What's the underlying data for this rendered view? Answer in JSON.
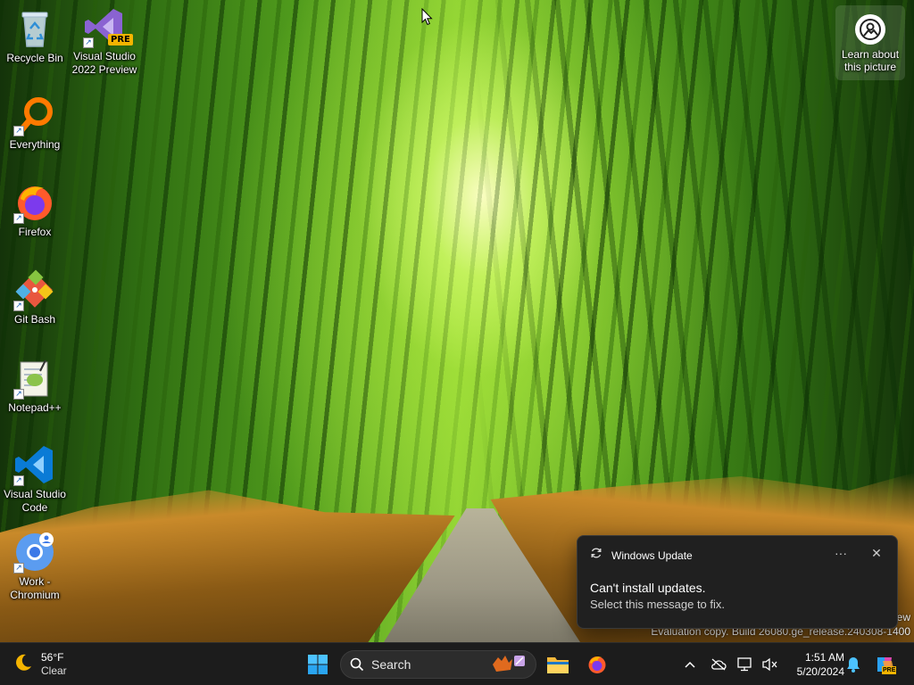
{
  "desktop_icons": [
    {
      "label_line1": "Recycle Bin",
      "label_line2": ""
    },
    {
      "label_line1": "Visual Studio",
      "label_line2": "2022 Preview",
      "badge": "PRE"
    },
    {
      "label_line1": "Everything",
      "label_line2": ""
    },
    {
      "label_line1": "Firefox",
      "label_line2": ""
    },
    {
      "label_line1": "Git Bash",
      "label_line2": ""
    },
    {
      "label_line1": "Notepad++",
      "label_line2": ""
    },
    {
      "label_line1": "Visual Studio",
      "label_line2": "Code"
    },
    {
      "label_line1": "Work -",
      "label_line2": "Chromium"
    }
  ],
  "learn_picture": {
    "line1": "Learn about",
    "line2": "this picture"
  },
  "watermark": {
    "line1": "ew",
    "line2": "Evaluation copy. Build 26080.ge_release.240308-1400"
  },
  "notification": {
    "app_name": "Windows Update",
    "more_label": "···",
    "close_label": "✕",
    "title": "Can't install updates.",
    "body": "Select this message to fix."
  },
  "taskbar": {
    "weather": {
      "temp": "56°F",
      "condition": "Clear"
    },
    "search_placeholder": "Search",
    "clock": {
      "time": "1:51 AM",
      "date": "5/20/2024"
    },
    "copilot_badge": "PRE"
  },
  "colors": {
    "accent": "#0078d4",
    "taskbar_bg": "#1c1c1c",
    "toast_bg": "#202020"
  }
}
